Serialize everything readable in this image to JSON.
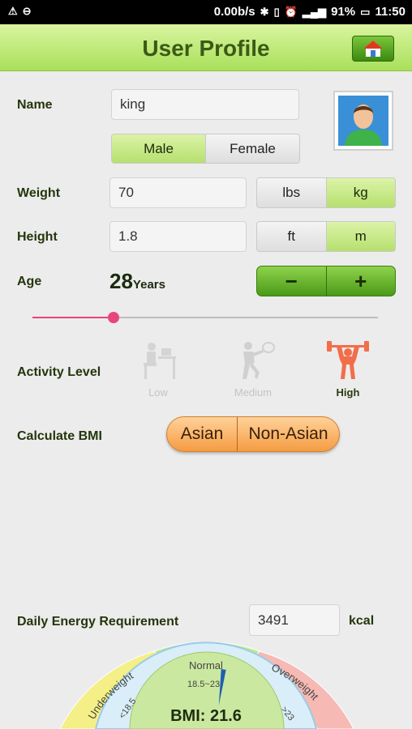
{
  "status_bar": {
    "speed": "0.00b/s",
    "battery": "91%",
    "time": "11:50"
  },
  "header": {
    "title": "User Profile"
  },
  "profile": {
    "name_label": "Name",
    "name_value": "king",
    "gender": {
      "options": [
        "Male",
        "Female"
      ],
      "selected": "Male"
    },
    "weight_label": "Weight",
    "weight_value": "70",
    "weight_units": [
      "lbs",
      "kg"
    ],
    "weight_unit_selected": "kg",
    "height_label": "Height",
    "height_value": "1.8",
    "height_units": [
      "ft",
      "m"
    ],
    "height_unit_selected": "m",
    "age_label": "Age",
    "age_value": "28",
    "age_unit": "Years",
    "stepper": {
      "minus": "−",
      "plus": "+"
    },
    "age_slider_fraction": 0.235
  },
  "activity": {
    "label": "Activity Level",
    "levels": [
      {
        "caption": "Low",
        "icon": "desk-person-icon"
      },
      {
        "caption": "Medium",
        "icon": "tennis-player-icon"
      },
      {
        "caption": "High",
        "icon": "weightlifter-icon"
      }
    ],
    "selected": "High"
  },
  "bmi_calc": {
    "label": "Calculate BMI",
    "options": [
      "Asian",
      "Non-Asian"
    ]
  },
  "energy": {
    "label": "Daily Energy Requirement",
    "value": "3491",
    "unit": "kcal"
  },
  "bmi_gauge": {
    "zones": [
      {
        "name": "Underweight",
        "range": "<18.5",
        "color": "#f4ef86"
      },
      {
        "name": "Normal",
        "range": "18.5~23",
        "color": "#bfe98a"
      },
      {
        "name": "Overweight",
        "range": ">23",
        "color": "#f6b9b4"
      }
    ],
    "readout": "BMI: 21.6",
    "value": 21.6
  },
  "colors": {
    "accent_green": "#8fd24c",
    "accent_orange": "#f59c42",
    "slider_pink": "#e8467a",
    "high_activity": "#f26e4a"
  }
}
